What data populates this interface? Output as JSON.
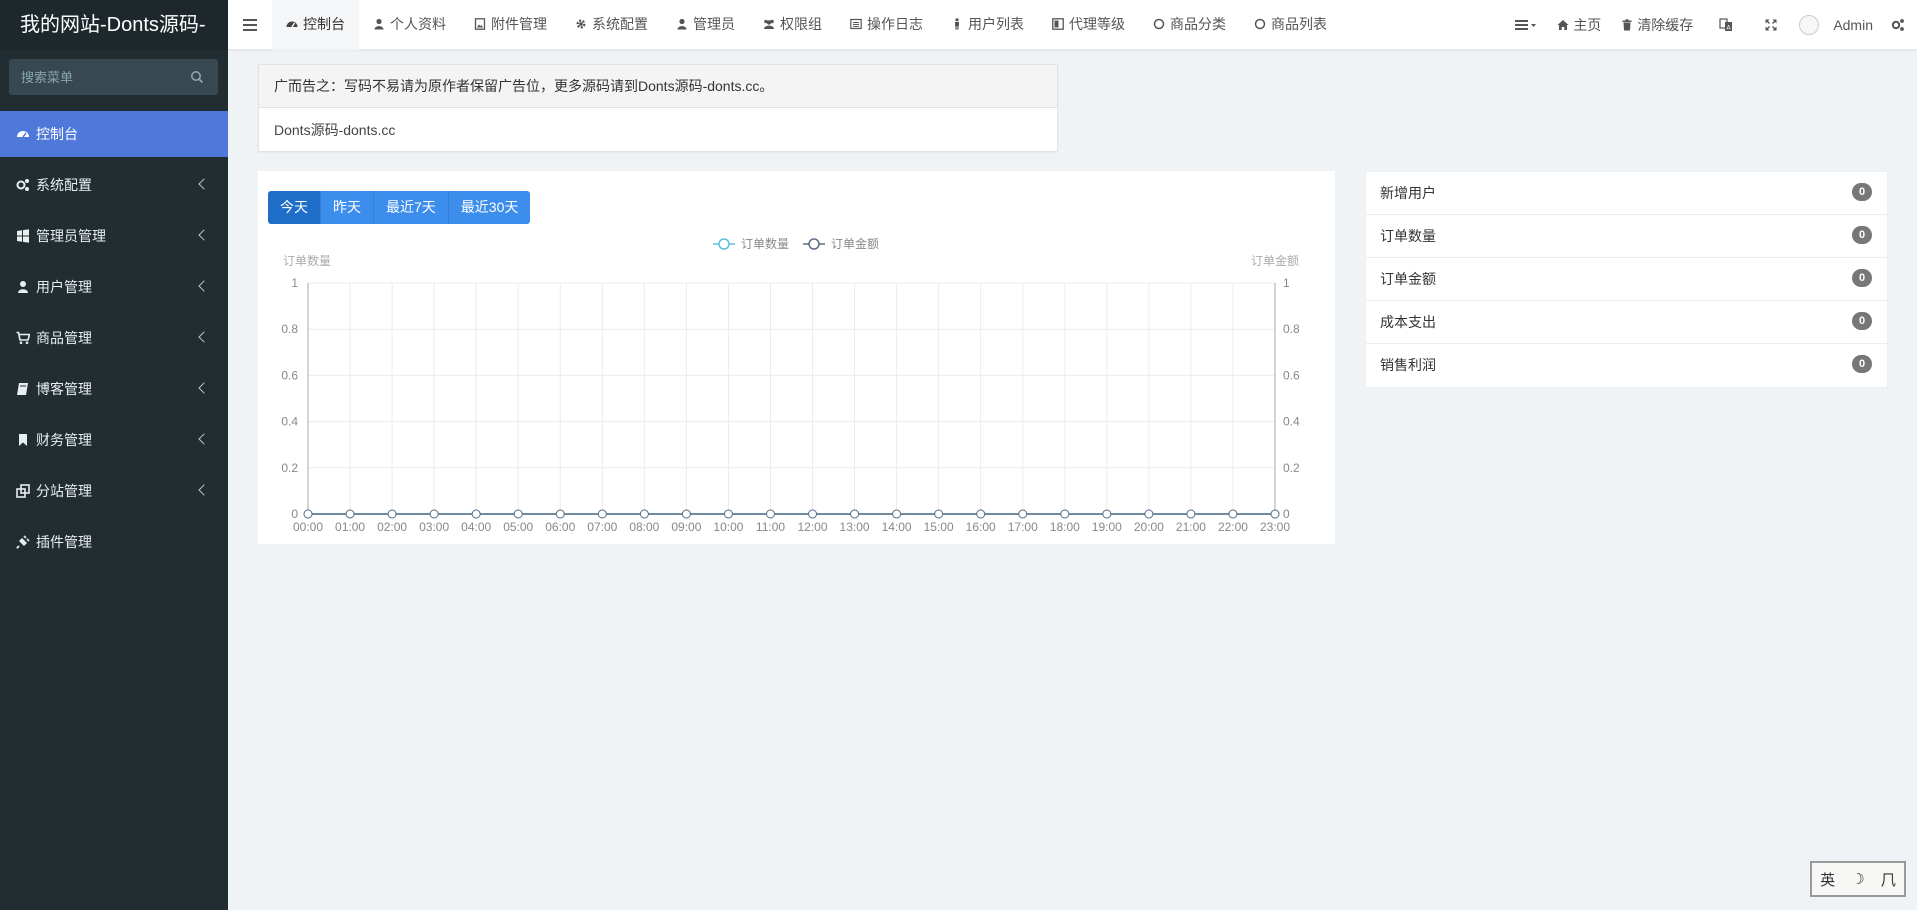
{
  "sidebar": {
    "logo": "我的网站-Donts源码-",
    "search_placeholder": "搜索菜单",
    "items": [
      {
        "label": "控制台"
      },
      {
        "label": "系统配置"
      },
      {
        "label": "管理员管理"
      },
      {
        "label": "用户管理"
      },
      {
        "label": "商品管理"
      },
      {
        "label": "博客管理"
      },
      {
        "label": "财务管理"
      },
      {
        "label": "分站管理"
      },
      {
        "label": "插件管理"
      }
    ]
  },
  "header": {
    "tabs": [
      {
        "label": "控制台"
      },
      {
        "label": "个人资料"
      },
      {
        "label": "附件管理"
      },
      {
        "label": "系统配置"
      },
      {
        "label": "管理员"
      },
      {
        "label": "权限组"
      },
      {
        "label": "操作日志"
      },
      {
        "label": "用户列表"
      },
      {
        "label": "代理等级"
      },
      {
        "label": "商品分类"
      },
      {
        "label": "商品列表"
      }
    ],
    "right": {
      "home": "主页",
      "clear_cache": "清除缓存",
      "user": "Admin"
    }
  },
  "notice": {
    "title": "广而告之：写码不易请为原作者保留广告位，更多源码请到Donts源码-donts.cc。",
    "body": "Donts源码-donts.cc"
  },
  "range_buttons": [
    "今天",
    "昨天",
    "最近7天",
    "最近30天"
  ],
  "chart_data": {
    "type": "line",
    "x": [
      "00:00",
      "01:00",
      "02:00",
      "03:00",
      "04:00",
      "05:00",
      "06:00",
      "07:00",
      "08:00",
      "09:00",
      "10:00",
      "11:00",
      "12:00",
      "13:00",
      "14:00",
      "15:00",
      "16:00",
      "17:00",
      "18:00",
      "19:00",
      "20:00",
      "21:00",
      "22:00",
      "23:00"
    ],
    "series": [
      {
        "name": "订单数量",
        "axis": "left",
        "color": "#5bc0de",
        "values": [
          0,
          0,
          0,
          0,
          0,
          0,
          0,
          0,
          0,
          0,
          0,
          0,
          0,
          0,
          0,
          0,
          0,
          0,
          0,
          0,
          0,
          0,
          0,
          0
        ]
      },
      {
        "name": "订单金额",
        "axis": "right",
        "color": "#5f6f86",
        "values": [
          0,
          0,
          0,
          0,
          0,
          0,
          0,
          0,
          0,
          0,
          0,
          0,
          0,
          0,
          0,
          0,
          0,
          0,
          0,
          0,
          0,
          0,
          0,
          0
        ]
      }
    ],
    "ylabel": "订单数量",
    "y2label": "订单金额",
    "ylim": [
      0,
      1
    ],
    "yticks": [
      "0",
      "0.2",
      "0.4",
      "0.6",
      "0.8",
      "1"
    ],
    "grid": true,
    "legend": "top"
  },
  "stats": [
    {
      "label": "新增用户",
      "value": "0"
    },
    {
      "label": "订单数量",
      "value": "0"
    },
    {
      "label": "订单金额",
      "value": "0"
    },
    {
      "label": "成本支出",
      "value": "0"
    },
    {
      "label": "销售利润",
      "value": "0"
    }
  ],
  "ime": {
    "lang": "英",
    "moon": "☽",
    "punct": "⺇"
  }
}
